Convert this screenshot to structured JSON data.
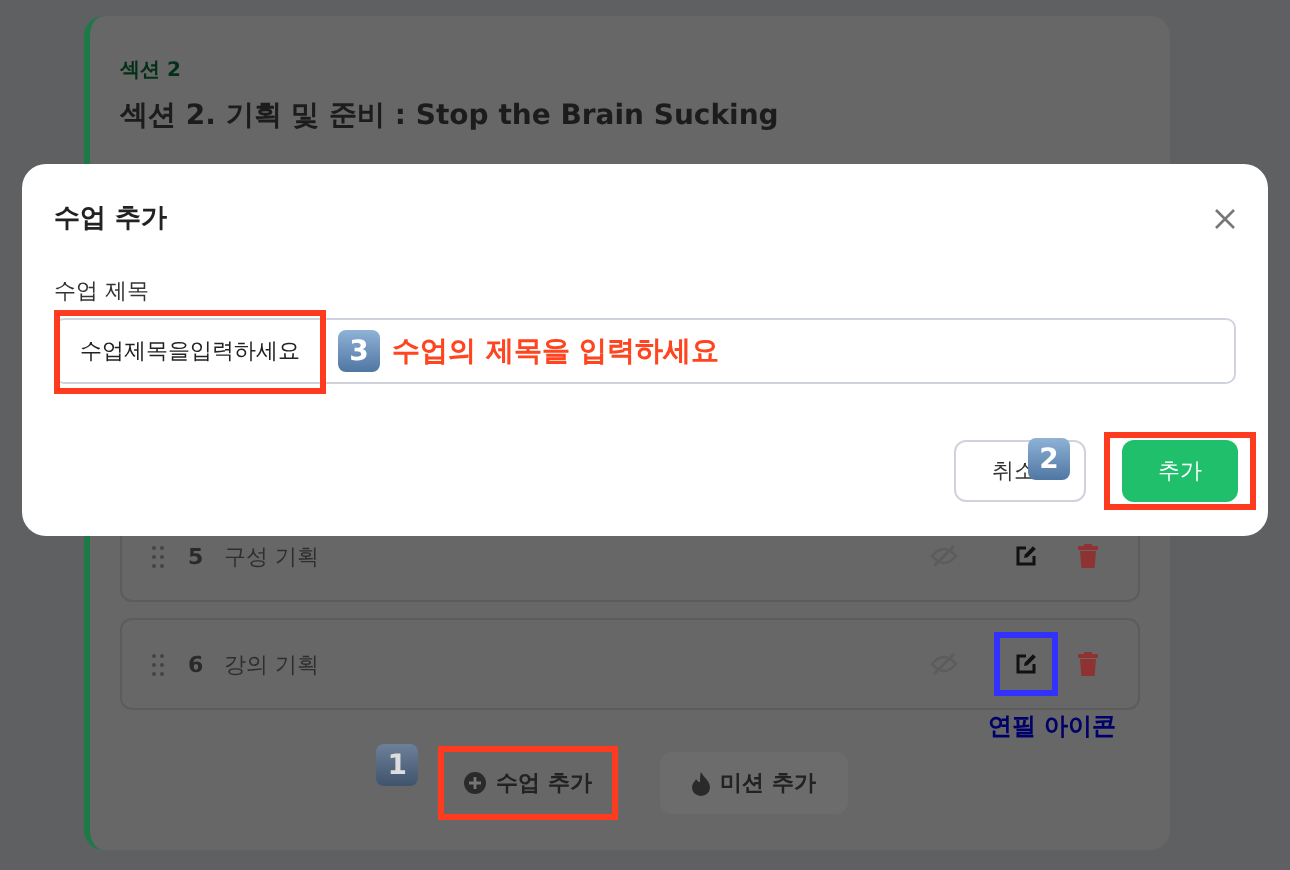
{
  "section": {
    "label": "섹션 2",
    "title": "섹션 2. 기획 및 준비 : Stop the Brain Sucking"
  },
  "lessons": [
    {
      "number": "5",
      "title": "구성 기획",
      "edit_highlighted": false
    },
    {
      "number": "6",
      "title": "강의 기획",
      "edit_highlighted": true,
      "note": "연필 아이콘"
    }
  ],
  "actions": [
    {
      "kind": "lesson",
      "label": "수업 추가",
      "highlighted": true,
      "badge": "1"
    },
    {
      "kind": "mission",
      "label": "미션 추가",
      "highlighted": false
    }
  ],
  "modal": {
    "title": "수업 추가",
    "field": {
      "label": "수업 제목",
      "value": "수업제목을입력하세요",
      "highlighted": true,
      "badge": "3",
      "note": "수업의 제목을 입력하세요"
    },
    "buttons": [
      {
        "kind": "secondary",
        "label": "취소",
        "highlighted": false,
        "badge": "2"
      },
      {
        "kind": "primary",
        "label": "추가",
        "highlighted": true
      }
    ]
  }
}
